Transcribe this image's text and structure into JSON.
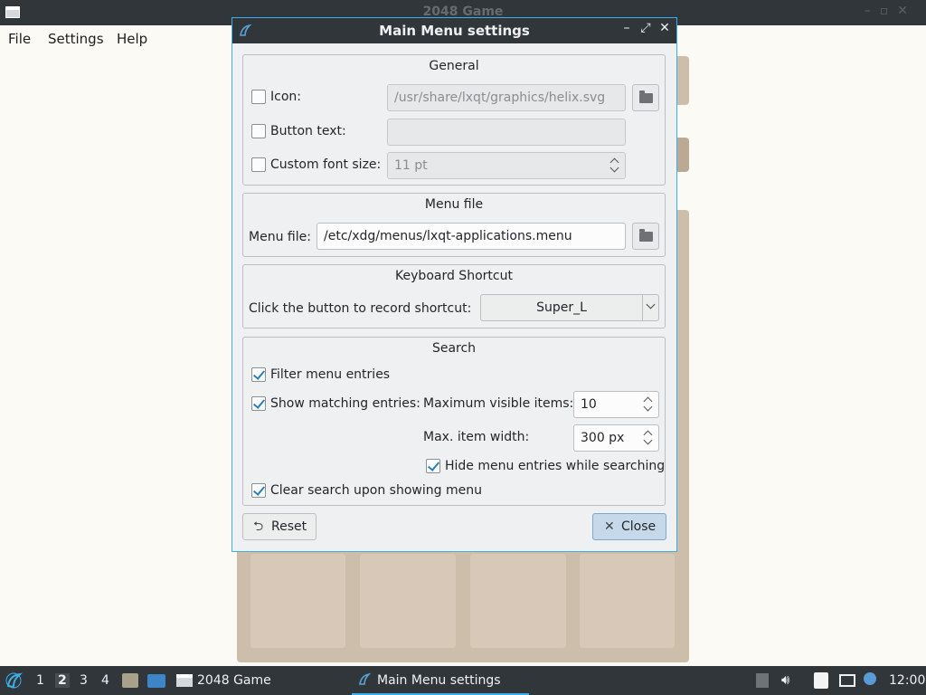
{
  "background_app": {
    "title": "2048 Game",
    "menu": [
      "File",
      "Settings",
      "Help"
    ]
  },
  "dialog": {
    "title": "Main Menu settings",
    "general": {
      "title": "General",
      "icon_label": "Icon:",
      "icon_checked": false,
      "icon_path": "/usr/share/lxqt/graphics/helix.svg",
      "button_text_label": "Button text:",
      "button_text_checked": false,
      "button_text_value": "",
      "font_size_label": "Custom font size:",
      "font_size_checked": false,
      "font_size_value": "11 pt"
    },
    "menu_file": {
      "title": "Menu file",
      "label": "Menu file:",
      "value": "/etc/xdg/menus/lxqt-applications.menu"
    },
    "shortcut": {
      "title": "Keyboard Shortcut",
      "label": "Click the button to record shortcut:",
      "value": "Super_L"
    },
    "search": {
      "title": "Search",
      "filter_label": "Filter menu entries",
      "filter_checked": true,
      "show_matching_label": "Show matching entries:",
      "show_matching_checked": true,
      "max_visible_label": "Maximum visible items:",
      "max_visible_value": "10",
      "max_width_label": "Max. item width:",
      "max_width_value": "300 px",
      "hide_entries_label": "Hide menu entries while searching",
      "hide_entries_checked": true,
      "clear_search_label": "Clear search upon showing menu",
      "clear_search_checked": true
    },
    "reset_label": "Reset",
    "close_label": "Close"
  },
  "taskbar": {
    "workspaces": [
      "1",
      "2",
      "3",
      "4"
    ],
    "active_workspace": "2",
    "tasks": [
      {
        "label": "2048 Game"
      },
      {
        "label": "Main Menu settings"
      }
    ],
    "clock": "12:00"
  },
  "colors": {
    "accent": "#3daee9",
    "titlebar": "#31363b",
    "dialog_bg": "#eff0f1",
    "board": "#cdbdab"
  }
}
